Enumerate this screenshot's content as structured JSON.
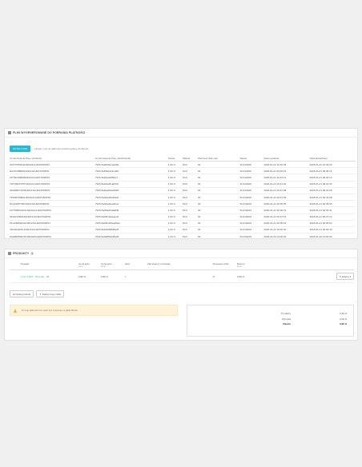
{
  "links_panel": {
    "title": "Pliki wygenerowane do pobrania płatności",
    "generate_button": "WYŚLIJ LINK",
    "hint": "Dotuje: Link do płatności został wysłany do klienta",
    "columns": [
      "Id zamówienia Payu (OrderId)",
      "Id zamówienia Payu (ExtOrderId)",
      "Kwota",
      "Waluta",
      "Ważność linku sek.",
      "Status",
      "Data wysłania",
      "Data aktualizacji"
    ],
    "rows": [
      [
        "H6TN72M4Q9190122GUEST000P01",
        "7626-5a9d23ecae09a",
        "1,00 zł",
        "PLN",
        "30",
        "SUCCESS",
        "2018-01-22 10:46:35",
        "2018-01-22 10:46:39"
      ],
      [
        "9HVLF2BB0Q190121GUEST000P01",
        "7626-5a65ab112cdd0",
        "1,00 zł",
        "PLN",
        "30",
        "SUCCESS",
        "2018-01-21 00:45:15",
        "2018-01-21 00:45:16"
      ],
      [
        "OP7R10SBM8190121GUEST000P01",
        "7626-5a64ad1f88ec7",
        "1,00 zł",
        "PLN",
        "30",
        "SUCCESS",
        "2018-01-21 00:43:12",
        "2018-01-21 00:43:12"
      ],
      [
        "TDT0SPZ7WT190121GUEST000P01",
        "7626-5a64ad4cab5c5",
        "1,00 zł",
        "PLN",
        "30",
        "SUCCESS",
        "2018-01-21 00:41:40",
        "2018-01-21 00:41:43"
      ],
      [
        "3DHM8X1PKD190121GUEST000P01",
        "7626-5a64ab0a2d06d",
        "1,00 zł",
        "PLN",
        "30",
        "SUCCESS",
        "2018-01-21 00:41:08",
        "2018-01-21 00:41:08"
      ],
      [
        "TFDMP4M8HH190121GUEST000P01",
        "7626-5a64ad94d4a2d",
        "1,00 zł",
        "PLN",
        "30",
        "SUCCESS",
        "2018-01-21 00:41:05",
        "2018-01-21 00:41:08"
      ],
      [
        "8LQGZ87TRF190121GUEST000P01",
        "7626-5a64ad2ee8bca",
        "1,00 zł",
        "PLN",
        "30",
        "SUCCESS",
        "2018-01-21 00:35:35",
        "2018-01-21 00:35:35"
      ],
      [
        "FCTWMK0HCH190121GUEST000P01",
        "7626-5a63a2019a8d6",
        "1,00 zł",
        "PLN",
        "30",
        "SUCCESS",
        "2018-01-21 00:30:41",
        "2018-01-21 00:30:41"
      ],
      [
        "3DHH3SMHHQ190121GUEST000P01",
        "7626-5a63b42aeaed1",
        "1,00 zł",
        "PLN",
        "30",
        "SUCCESS",
        "2018-01-21 00:27:15",
        "2018-01-21 00:27:13"
      ],
      [
        "P1GZ82MRUH190121GUEST000P01",
        "7626-5a63b425ea6bde",
        "1,00 zł",
        "PLN",
        "30",
        "SUCCESS",
        "2018-01-21 00:05:54",
        "2018-01-21 00:05:54"
      ],
      [
        "JSGZ04HWL1190121GUEST000P01",
        "7626-5a63d098d5a25",
        "1,00 zł",
        "PLN",
        "30",
        "SUCCESS",
        "2018-01-21 00:02:40",
        "2018-01-21 00:02:40"
      ],
      [
        "WHHBZM3CSP190120GUEST000P01",
        "7626-5a62859d48a45",
        "1,00 zł",
        "PLN",
        "30",
        "SUCCESS",
        "2018-01-20 19:00:30",
        "2018-01-20 19:00:30"
      ]
    ]
  },
  "products_panel": {
    "title": "PRODUKTY",
    "count": "1",
    "columns": {
      "product": "Produkt",
      "unit_price": "Cena jedn.",
      "unit_price_sub": "Netto",
      "unit_price2": "Cena jedn.",
      "unit_price2_sub": "Brutto",
      "qty": "Ilość",
      "refunded": "Zamówiony pozostały",
      "available": "Dostępne ilość",
      "total": "Razem",
      "total_sub": "Brutto"
    },
    "row": {
      "product": "1 KLI TEST - Rozmiar : 38",
      "unit_price": "0,80 zł",
      "unit_price2": "0,99 zł",
      "qty": "1",
      "available": "9",
      "total": "0,99 zł",
      "edit": "Edytuj"
    },
    "add_product": "Dodaj produkt",
    "add_discount": "Dodaj nowy rabat",
    "alert": "Ten typ płatności nie może być zmieniony w gdzie Brutto",
    "totals": [
      {
        "label": "Produkty",
        "value": "0,99 zł"
      },
      {
        "label": "Wysyłka",
        "value": "0,00 zł"
      },
      {
        "label": "Razem",
        "value": "0,99 zł"
      }
    ]
  }
}
